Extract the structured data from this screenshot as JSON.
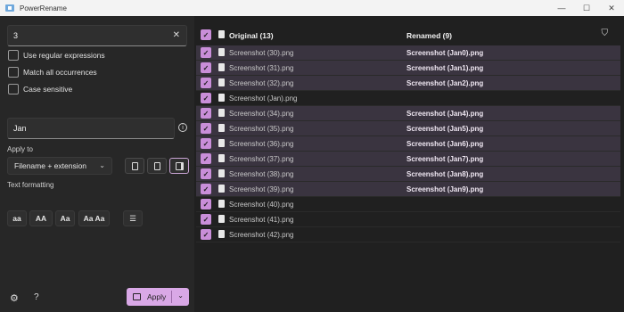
{
  "window": {
    "title": "PowerRename",
    "controls": [
      "—",
      "☐",
      "✕"
    ]
  },
  "search": {
    "value": "3",
    "clear_icon": "✕"
  },
  "options": [
    {
      "label": "Use regular expressions",
      "checked": false
    },
    {
      "label": "Match all occurrences",
      "checked": false
    },
    {
      "label": "Case sensitive",
      "checked": false
    }
  ],
  "replace": {
    "value": "Jan",
    "info_icon": "i"
  },
  "apply_to": {
    "label": "Apply to",
    "selected": "Filename + extension"
  },
  "text_formatting": {
    "label": "Text formatting",
    "buttons": [
      "aa",
      "AA",
      "Aa",
      "Aa Aa"
    ]
  },
  "footer": {
    "apply_label": "Apply",
    "help_icon": "?",
    "settings_icon": "⚙"
  },
  "list": {
    "original_header": "Original (13)",
    "renamed_header": "Renamed (9)",
    "rows": [
      {
        "original": "Screenshot (30).png",
        "renamed": "Screenshot (Jan0).png"
      },
      {
        "original": "Screenshot (31).png",
        "renamed": "Screenshot (Jan1).png"
      },
      {
        "original": "Screenshot (32).png",
        "renamed": "Screenshot (Jan2).png"
      },
      {
        "original": "Screenshot (Jan).png",
        "renamed": ""
      },
      {
        "original": "Screenshot (34).png",
        "renamed": "Screenshot (Jan4).png"
      },
      {
        "original": "Screenshot (35).png",
        "renamed": "Screenshot (Jan5).png"
      },
      {
        "original": "Screenshot (36).png",
        "renamed": "Screenshot (Jan6).png"
      },
      {
        "original": "Screenshot (37).png",
        "renamed": "Screenshot (Jan7).png"
      },
      {
        "original": "Screenshot (38).png",
        "renamed": "Screenshot (Jan8).png"
      },
      {
        "original": "Screenshot (39).png",
        "renamed": "Screenshot (Jan9).png"
      },
      {
        "original": "Screenshot (40).png",
        "renamed": ""
      },
      {
        "original": "Screenshot (41).png",
        "renamed": ""
      },
      {
        "original": "Screenshot (42).png",
        "renamed": ""
      }
    ]
  },
  "colors": {
    "accent": "#c98ed9",
    "apply_bg": "#d9a8e6",
    "renamed_row": "#3a3440"
  }
}
